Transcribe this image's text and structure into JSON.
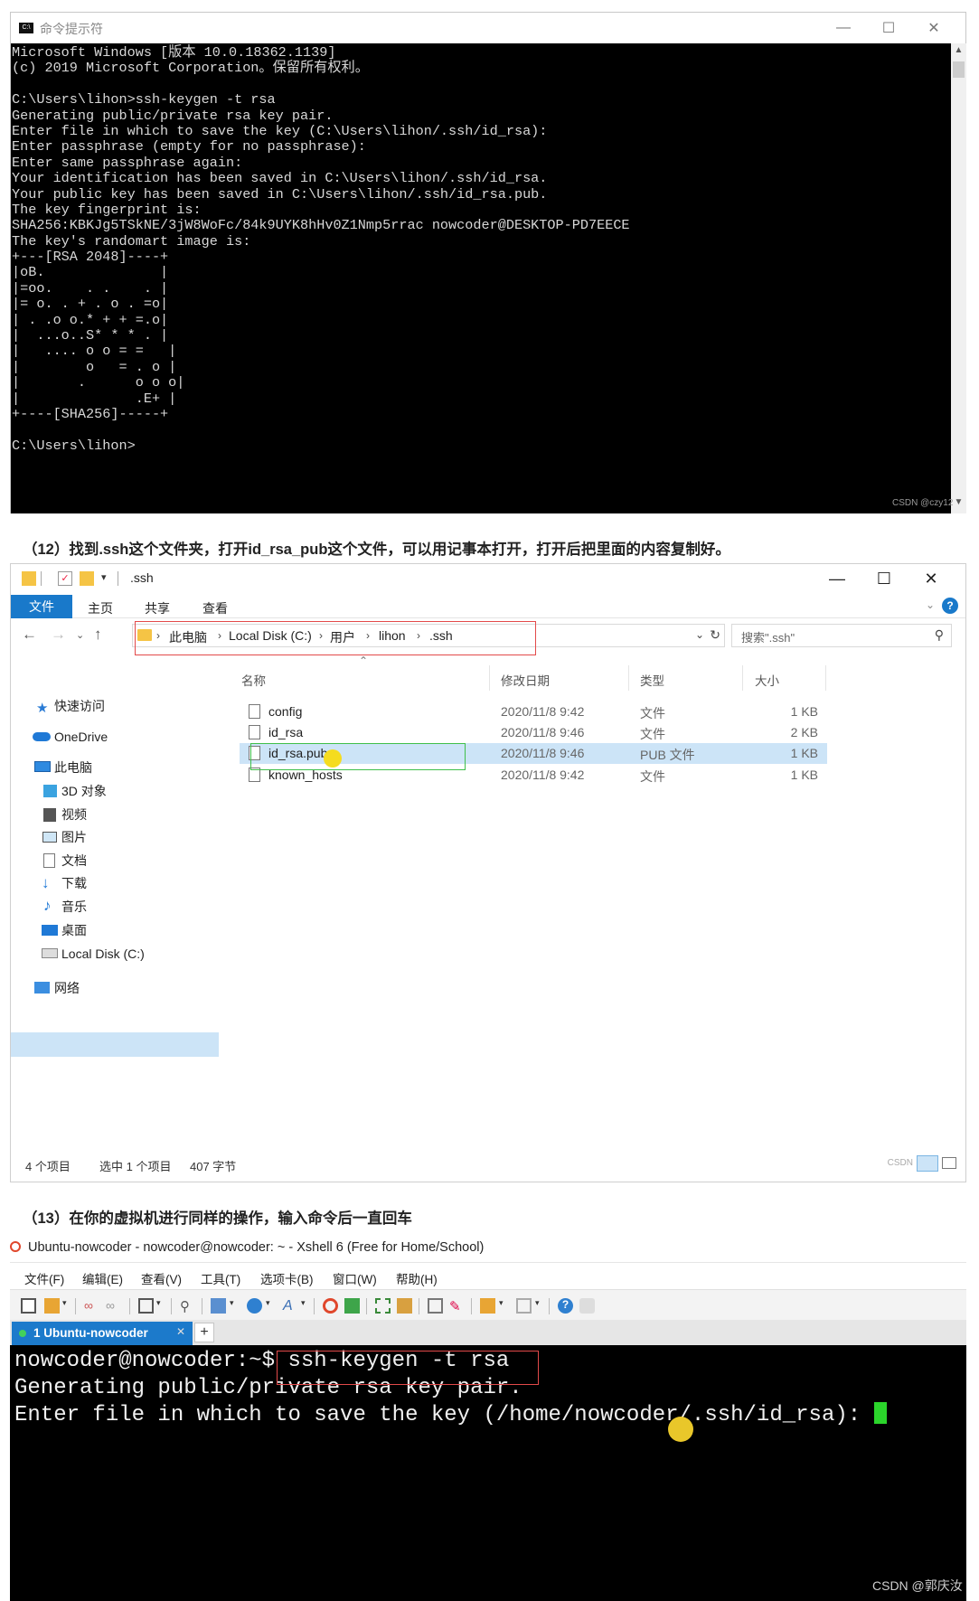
{
  "cmd": {
    "title": "命令提示符",
    "lines": [
      "Microsoft Windows [版本 10.0.18362.1139]",
      "(c) 2019 Microsoft Corporation。保留所有权利。",
      "",
      "C:\\Users\\lihon>ssh-keygen -t rsa",
      "Generating public/private rsa key pair.",
      "Enter file in which to save the key (C:\\Users\\lihon/.ssh/id_rsa):",
      "Enter passphrase (empty for no passphrase):",
      "Enter same passphrase again:",
      "Your identification has been saved in C:\\Users\\lihon/.ssh/id_rsa.",
      "Your public key has been saved in C:\\Users\\lihon/.ssh/id_rsa.pub.",
      "The key fingerprint is:",
      "SHA256:KBKJg5TSkNE/3jW8WoFc/84k9UYK8hHv0Z1Nmp5rrac nowcoder@DESKTOP-PD7EECE",
      "The key's randomart image is:",
      "+---[RSA 2048]----+",
      "|oB.              |",
      "|=oo.    . .    . |",
      "|= o. . + . o . =o|",
      "| . .o o.* + + =.o|",
      "|  ...o..S* * * . |",
      "|   .... o o = =   |",
      "|        o   = . o |",
      "|       .      o o o|",
      "|              .E+ |",
      "+----[SHA256]-----+",
      "",
      "C:\\Users\\lihon>"
    ],
    "watermark": "CSDN @czy12"
  },
  "captions": {
    "step12": "（12）找到.ssh这个文件夹，打开id_rsa_pub这个文件，可以用记事本打开，打开后把里面的内容复制好。",
    "step13": "（13）在你的虚拟机进行同样的操作，输入命令后一直回车"
  },
  "explorer": {
    "title": ".ssh",
    "ribbon_tabs": [
      "文件",
      "主页",
      "共享",
      "查看"
    ],
    "breadcrumb": [
      "此电脑",
      "Local Disk (C:)",
      "用户",
      "lihon",
      ".ssh"
    ],
    "search_placeholder": "搜索\".ssh\"",
    "nav": {
      "quick_access": "快速访问",
      "onedrive": "OneDrive",
      "this_pc": "此电脑",
      "objects3d": "3D 对象",
      "videos": "视频",
      "pictures": "图片",
      "documents": "文档",
      "downloads": "下载",
      "music": "音乐",
      "desktop": "桌面",
      "local_disk": "Local Disk (C:)",
      "network": "网络"
    },
    "columns": {
      "name": "名称",
      "date": "修改日期",
      "type": "类型",
      "size": "大小"
    },
    "files": [
      {
        "name": "config",
        "date": "2020/11/8 9:42",
        "type": "文件",
        "size": "1 KB"
      },
      {
        "name": "id_rsa",
        "date": "2020/11/8 9:46",
        "type": "文件",
        "size": "2 KB"
      },
      {
        "name": "id_rsa.pub",
        "date": "2020/11/8 9:46",
        "type": "PUB 文件",
        "size": "1 KB"
      },
      {
        "name": "known_hosts",
        "date": "2020/11/8 9:42",
        "type": "文件",
        "size": "1 KB"
      }
    ],
    "status": {
      "count": "4 个项目",
      "selected": "选中 1 个项目",
      "bytes": "407 字节"
    },
    "watermark": "CSDN"
  },
  "xshell": {
    "title": "Ubuntu-nowcoder - nowcoder@nowcoder: ~ - Xshell 6 (Free for Home/School)",
    "menu": [
      "文件(F)",
      "编辑(E)",
      "查看(V)",
      "工具(T)",
      "选项卡(B)",
      "窗口(W)",
      "帮助(H)"
    ],
    "tab_label": "1 Ubuntu-nowcoder",
    "prompt": "nowcoder@nowcoder:~$ ",
    "command": "ssh-keygen -t rsa",
    "line2": "Generating public/private rsa key pair.",
    "line3": "Enter file in which to save the key (/home/nowcoder/.ssh/id_rsa): ",
    "cursor_color": "#2bd52b"
  },
  "watermark_bottom": "CSDN @郭庆汝",
  "colors": {
    "accent": "#1979ca",
    "highlight_red": "#e34a4a",
    "highlight_green": "#3fbf4a",
    "selection": "#cce4f7"
  }
}
